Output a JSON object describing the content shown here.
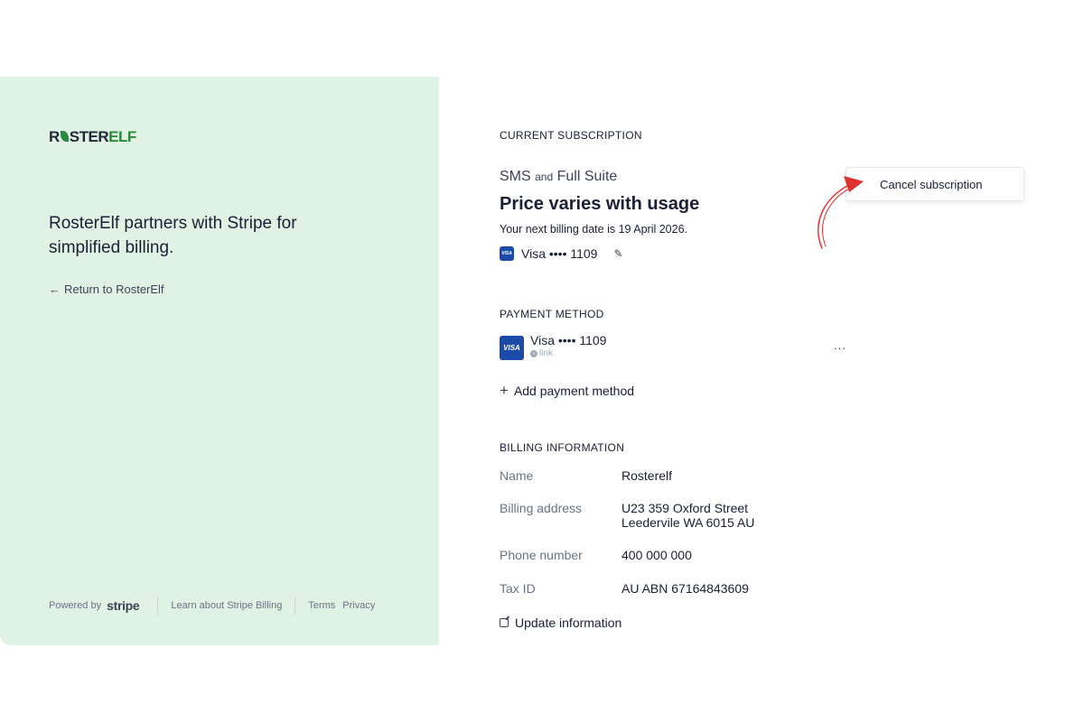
{
  "brand": {
    "logo_part1": "R",
    "logo_part2": "STER",
    "logo_part3": "ELF",
    "tagline": "RosterElf partners with Stripe for simplified billing.",
    "return_link": "Return to RosterElf"
  },
  "footer": {
    "powered_by": "Powered by",
    "stripe": "stripe",
    "learn": "Learn about Stripe Billing",
    "terms": "Terms",
    "privacy": "Privacy"
  },
  "subscription": {
    "section_title": "CURRENT SUBSCRIPTION",
    "plan_a": "SMS",
    "plan_and": "and",
    "plan_b": "Full Suite",
    "price": "Price varies with usage",
    "next_billing": "Your next billing date is 19 April 2026.",
    "card_label": "Visa •••• 1109",
    "cancel_label": "Cancel subscription"
  },
  "payment": {
    "section_title": "PAYMENT METHOD",
    "card_label": "Visa •••• 1109",
    "card_sub": "link",
    "add_label": "Add payment method",
    "more": "..."
  },
  "billing": {
    "section_title": "BILLING INFORMATION",
    "rows": [
      {
        "label": "Name",
        "value": "Rosterelf"
      },
      {
        "label": "Billing address",
        "value": "U23 359 Oxford Street",
        "value2": "Leedervile WA 6015 AU"
      },
      {
        "label": "Phone number",
        "value": "400 000 000"
      },
      {
        "label": "Tax ID",
        "value": "AU ABN 67164843609"
      }
    ],
    "update_label": "Update information"
  },
  "colors": {
    "left_panel_bg": "#e0f2e3",
    "brand_green": "#2a8a3e",
    "visa_blue": "#1a4ba8",
    "annotation_red": "#e03030"
  }
}
